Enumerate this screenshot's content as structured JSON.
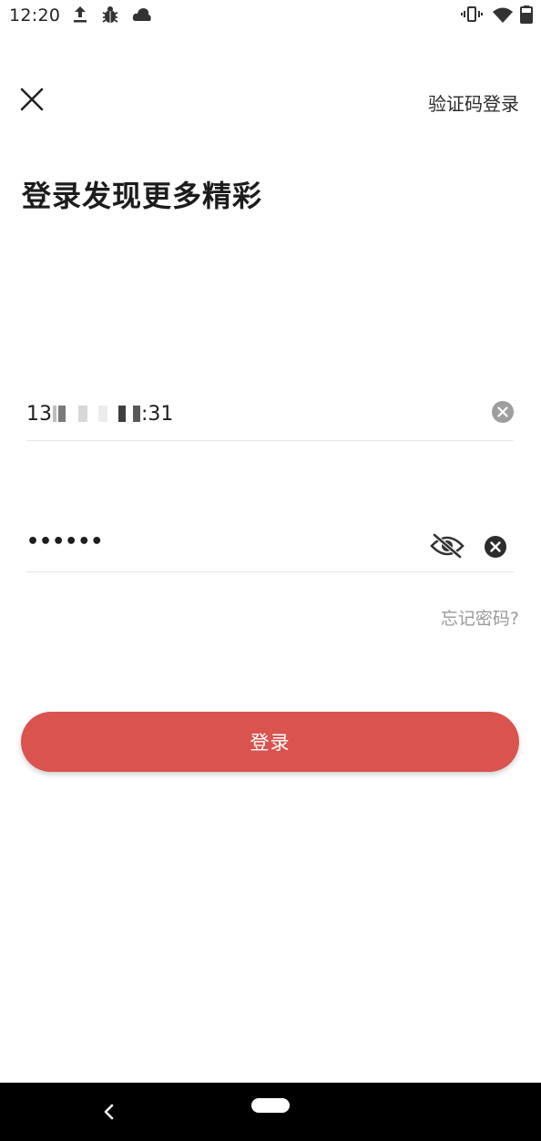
{
  "status_bar": {
    "time": "12:20",
    "icons": [
      "upload-icon",
      "bug-icon",
      "cloud-icon",
      "vibrate-icon",
      "wifi-icon",
      "battery-icon"
    ]
  },
  "header": {
    "close_icon": "close-icon",
    "sms_login_label": "验证码登录"
  },
  "title": "登录发现更多精彩",
  "phone": {
    "prefix": "13",
    "suffix": ":31",
    "clear_icon": "clear-circle-icon"
  },
  "password": {
    "value": "••••••",
    "visibility_icon": "eye-off-icon",
    "clear_icon": "clear-circle-icon"
  },
  "forgot_password": "忘记密码?",
  "login_button": "登录",
  "nav_bar": {
    "back_icon": "back-chevron-icon",
    "home_icon": "home-pill-icon"
  },
  "colors": {
    "accent": "#d9534f",
    "hint": "#9a9a9a",
    "divider": "#e6e6e6"
  }
}
